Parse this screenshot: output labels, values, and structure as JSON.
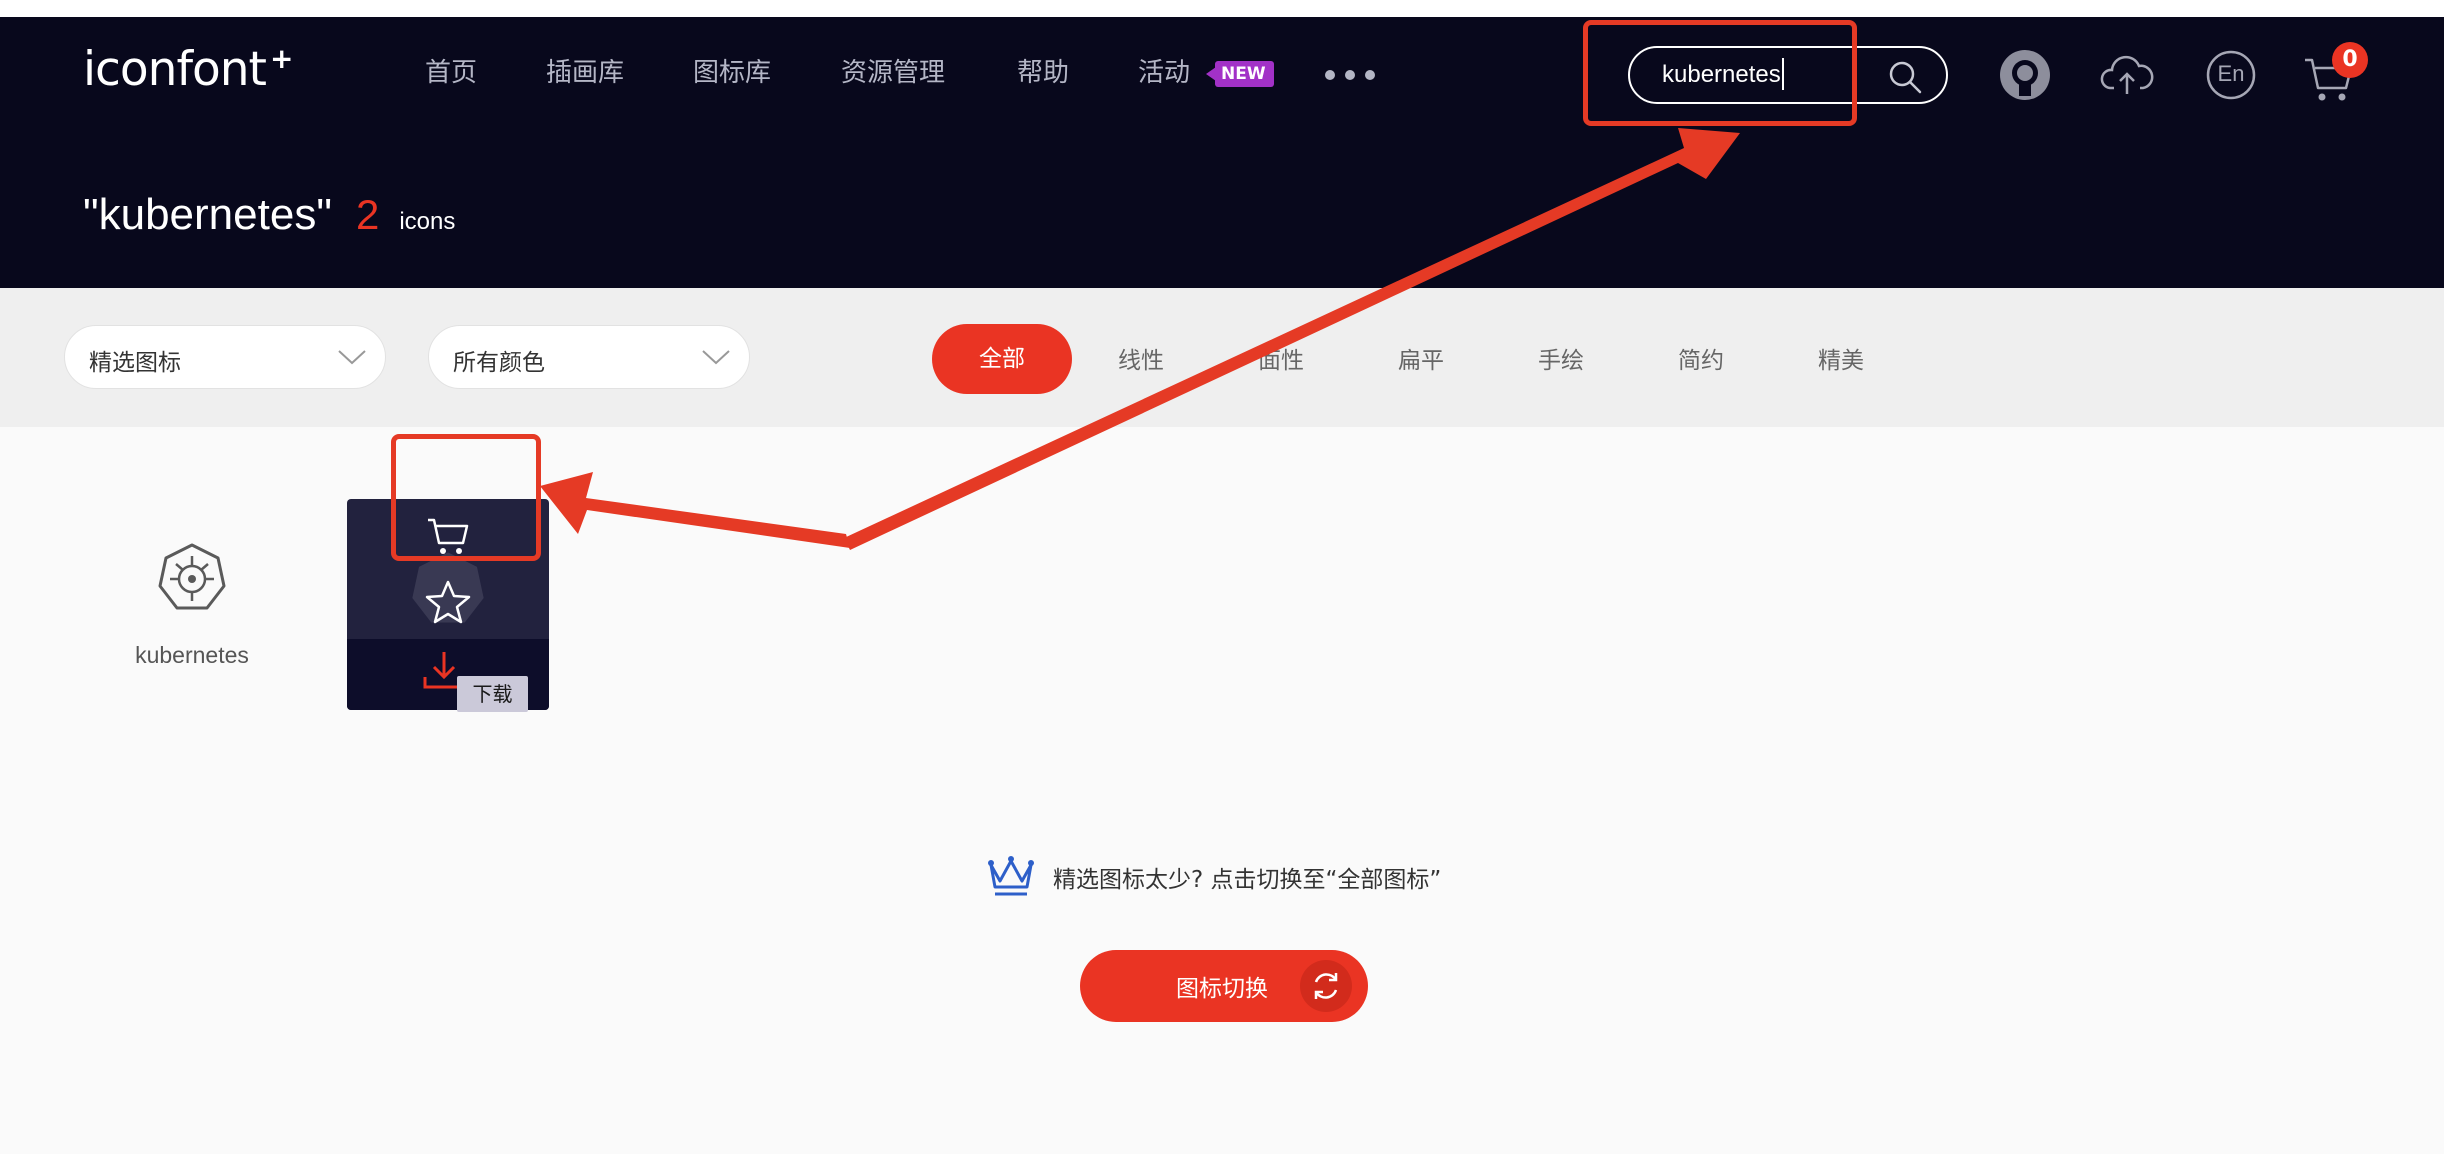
{
  "header": {
    "logo": "iconfont",
    "logo_plus": "+",
    "nav": [
      "首页",
      "插画库",
      "图标库",
      "资源管理",
      "帮助",
      "活动"
    ],
    "new_badge": "NEW",
    "more_icon": "more-dots-icon",
    "search": {
      "value": "kubernetes",
      "icon": "search-icon"
    },
    "icons": [
      "github-icon",
      "upload-cloud-icon",
      "language-en-icon",
      "cart-icon"
    ],
    "lang_label": "En",
    "cart_count": "0",
    "colors": {
      "background": "#08081c",
      "accent": "#ea3423",
      "nav_text": "#b4b6c6"
    }
  },
  "results": {
    "query": "\"kubernetes\"",
    "count": "2",
    "unit": "icons"
  },
  "filters": {
    "selects": [
      "精选图标",
      "所有颜色"
    ],
    "tabs": [
      "全部",
      "线性",
      "面性",
      "扁平",
      "手绘",
      "简约",
      "精美"
    ],
    "active_tab": "全部"
  },
  "icons": [
    {
      "name": "kubernetes",
      "icon": "kubernetes-helm-icon"
    }
  ],
  "hover_card": {
    "actions": [
      "cart-icon",
      "star-icon",
      "download-icon"
    ],
    "tooltip": "下载"
  },
  "hint": {
    "icon": "crown-icon",
    "text": "精选图标太少? 点击切换至“全部图标”"
  },
  "switch_button": {
    "label": "图标切换",
    "icon": "refresh-icon"
  },
  "annotations": {
    "color": "#e53a25"
  }
}
